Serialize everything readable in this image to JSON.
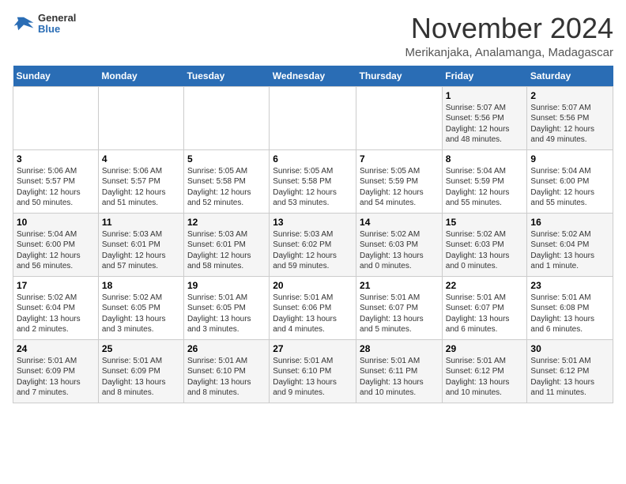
{
  "header": {
    "logo": {
      "general": "General",
      "blue": "Blue"
    },
    "month": "November 2024",
    "location": "Merikanjaka, Analamanga, Madagascar"
  },
  "weekdays": [
    "Sunday",
    "Monday",
    "Tuesday",
    "Wednesday",
    "Thursday",
    "Friday",
    "Saturday"
  ],
  "weeks": [
    [
      {
        "day": "",
        "info": ""
      },
      {
        "day": "",
        "info": ""
      },
      {
        "day": "",
        "info": ""
      },
      {
        "day": "",
        "info": ""
      },
      {
        "day": "",
        "info": ""
      },
      {
        "day": "1",
        "info": "Sunrise: 5:07 AM\nSunset: 5:56 PM\nDaylight: 12 hours\nand 48 minutes."
      },
      {
        "day": "2",
        "info": "Sunrise: 5:07 AM\nSunset: 5:56 PM\nDaylight: 12 hours\nand 49 minutes."
      }
    ],
    [
      {
        "day": "3",
        "info": "Sunrise: 5:06 AM\nSunset: 5:57 PM\nDaylight: 12 hours\nand 50 minutes."
      },
      {
        "day": "4",
        "info": "Sunrise: 5:06 AM\nSunset: 5:57 PM\nDaylight: 12 hours\nand 51 minutes."
      },
      {
        "day": "5",
        "info": "Sunrise: 5:05 AM\nSunset: 5:58 PM\nDaylight: 12 hours\nand 52 minutes."
      },
      {
        "day": "6",
        "info": "Sunrise: 5:05 AM\nSunset: 5:58 PM\nDaylight: 12 hours\nand 53 minutes."
      },
      {
        "day": "7",
        "info": "Sunrise: 5:05 AM\nSunset: 5:59 PM\nDaylight: 12 hours\nand 54 minutes."
      },
      {
        "day": "8",
        "info": "Sunrise: 5:04 AM\nSunset: 5:59 PM\nDaylight: 12 hours\nand 55 minutes."
      },
      {
        "day": "9",
        "info": "Sunrise: 5:04 AM\nSunset: 6:00 PM\nDaylight: 12 hours\nand 55 minutes."
      }
    ],
    [
      {
        "day": "10",
        "info": "Sunrise: 5:04 AM\nSunset: 6:00 PM\nDaylight: 12 hours\nand 56 minutes."
      },
      {
        "day": "11",
        "info": "Sunrise: 5:03 AM\nSunset: 6:01 PM\nDaylight: 12 hours\nand 57 minutes."
      },
      {
        "day": "12",
        "info": "Sunrise: 5:03 AM\nSunset: 6:01 PM\nDaylight: 12 hours\nand 58 minutes."
      },
      {
        "day": "13",
        "info": "Sunrise: 5:03 AM\nSunset: 6:02 PM\nDaylight: 12 hours\nand 59 minutes."
      },
      {
        "day": "14",
        "info": "Sunrise: 5:02 AM\nSunset: 6:03 PM\nDaylight: 13 hours\nand 0 minutes."
      },
      {
        "day": "15",
        "info": "Sunrise: 5:02 AM\nSunset: 6:03 PM\nDaylight: 13 hours\nand 0 minutes."
      },
      {
        "day": "16",
        "info": "Sunrise: 5:02 AM\nSunset: 6:04 PM\nDaylight: 13 hours\nand 1 minute."
      }
    ],
    [
      {
        "day": "17",
        "info": "Sunrise: 5:02 AM\nSunset: 6:04 PM\nDaylight: 13 hours\nand 2 minutes."
      },
      {
        "day": "18",
        "info": "Sunrise: 5:02 AM\nSunset: 6:05 PM\nDaylight: 13 hours\nand 3 minutes."
      },
      {
        "day": "19",
        "info": "Sunrise: 5:01 AM\nSunset: 6:05 PM\nDaylight: 13 hours\nand 3 minutes."
      },
      {
        "day": "20",
        "info": "Sunrise: 5:01 AM\nSunset: 6:06 PM\nDaylight: 13 hours\nand 4 minutes."
      },
      {
        "day": "21",
        "info": "Sunrise: 5:01 AM\nSunset: 6:07 PM\nDaylight: 13 hours\nand 5 minutes."
      },
      {
        "day": "22",
        "info": "Sunrise: 5:01 AM\nSunset: 6:07 PM\nDaylight: 13 hours\nand 6 minutes."
      },
      {
        "day": "23",
        "info": "Sunrise: 5:01 AM\nSunset: 6:08 PM\nDaylight: 13 hours\nand 6 minutes."
      }
    ],
    [
      {
        "day": "24",
        "info": "Sunrise: 5:01 AM\nSunset: 6:09 PM\nDaylight: 13 hours\nand 7 minutes."
      },
      {
        "day": "25",
        "info": "Sunrise: 5:01 AM\nSunset: 6:09 PM\nDaylight: 13 hours\nand 8 minutes."
      },
      {
        "day": "26",
        "info": "Sunrise: 5:01 AM\nSunset: 6:10 PM\nDaylight: 13 hours\nand 8 minutes."
      },
      {
        "day": "27",
        "info": "Sunrise: 5:01 AM\nSunset: 6:10 PM\nDaylight: 13 hours\nand 9 minutes."
      },
      {
        "day": "28",
        "info": "Sunrise: 5:01 AM\nSunset: 6:11 PM\nDaylight: 13 hours\nand 10 minutes."
      },
      {
        "day": "29",
        "info": "Sunrise: 5:01 AM\nSunset: 6:12 PM\nDaylight: 13 hours\nand 10 minutes."
      },
      {
        "day": "30",
        "info": "Sunrise: 5:01 AM\nSunset: 6:12 PM\nDaylight: 13 hours\nand 11 minutes."
      }
    ]
  ]
}
